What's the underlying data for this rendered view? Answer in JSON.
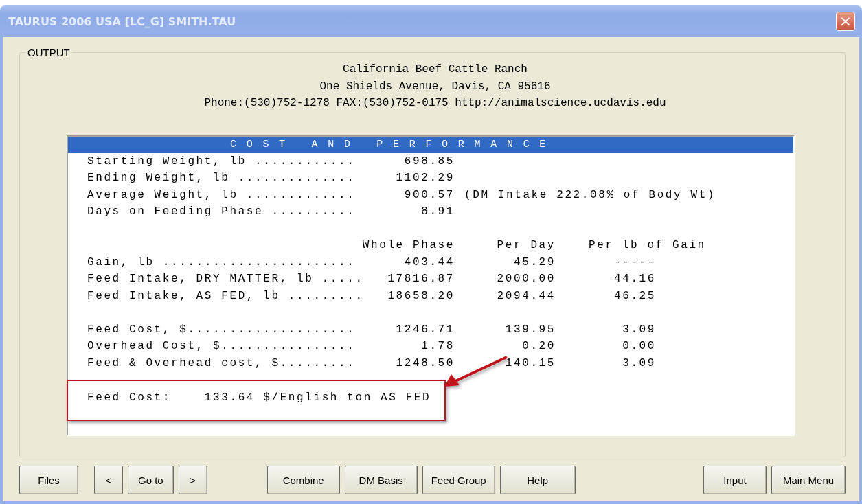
{
  "window": {
    "title": "TAURUS 2006 USA [LC_G] SMITH.TAU",
    "close": "×"
  },
  "output": {
    "legend": "OUTPUT",
    "header_lines": [
      "California Beef Cattle Ranch",
      "One Shields Avenue, Davis, CA 95616",
      "Phone:(530)752-1278 FAX:(530)752-0175 http://animalscience.ucdavis.edu"
    ],
    "report": {
      "banner": "COST AND PERFORMANCE",
      "weights": [
        {
          "label": "Starting Weight, lb ............",
          "value": "698.85"
        },
        {
          "label": "Ending Weight, lb ..............",
          "value": "1102.29"
        },
        {
          "label": "Average Weight, lb .............",
          "value": "900.57",
          "note": "(DM Intake 222.08% of Body Wt)"
        },
        {
          "label": "Days on Feeding Phase ..........",
          "value": "8.91"
        }
      ],
      "columns": [
        "Whole Phase",
        "Per Day",
        "Per lb of Gain"
      ],
      "intake_rows": [
        {
          "label": "Gain, lb .......................",
          "values": [
            "403.44",
            "45.29",
            "-----"
          ]
        },
        {
          "label": "Feed Intake, DRY MATTER, lb .....",
          "values": [
            "17816.87",
            "2000.00",
            "44.16"
          ]
        },
        {
          "label": "Feed Intake, AS FED, lb .........",
          "values": [
            "18658.20",
            "2094.44",
            "46.25"
          ]
        }
      ],
      "cost_rows": [
        {
          "label": "Feed Cost, $....................",
          "values": [
            "1246.71",
            "139.95",
            "3.09"
          ]
        },
        {
          "label": "Overhead Cost, $................",
          "values": [
            "1.78",
            "0.20",
            "0.00"
          ]
        },
        {
          "label": "Feed & Overhead cost, $.........",
          "values": [
            "1248.50",
            "140.15",
            "3.09"
          ]
        }
      ],
      "highlight": "Feed Cost:    133.64 $/English ton AS FED"
    }
  },
  "button_groups": [
    [
      "Files"
    ],
    [
      "<",
      "Go to",
      ">"
    ],
    [
      "Combine",
      "DM Basis",
      "Feed Group",
      "Help"
    ],
    [
      "Input",
      "Main Menu"
    ]
  ]
}
